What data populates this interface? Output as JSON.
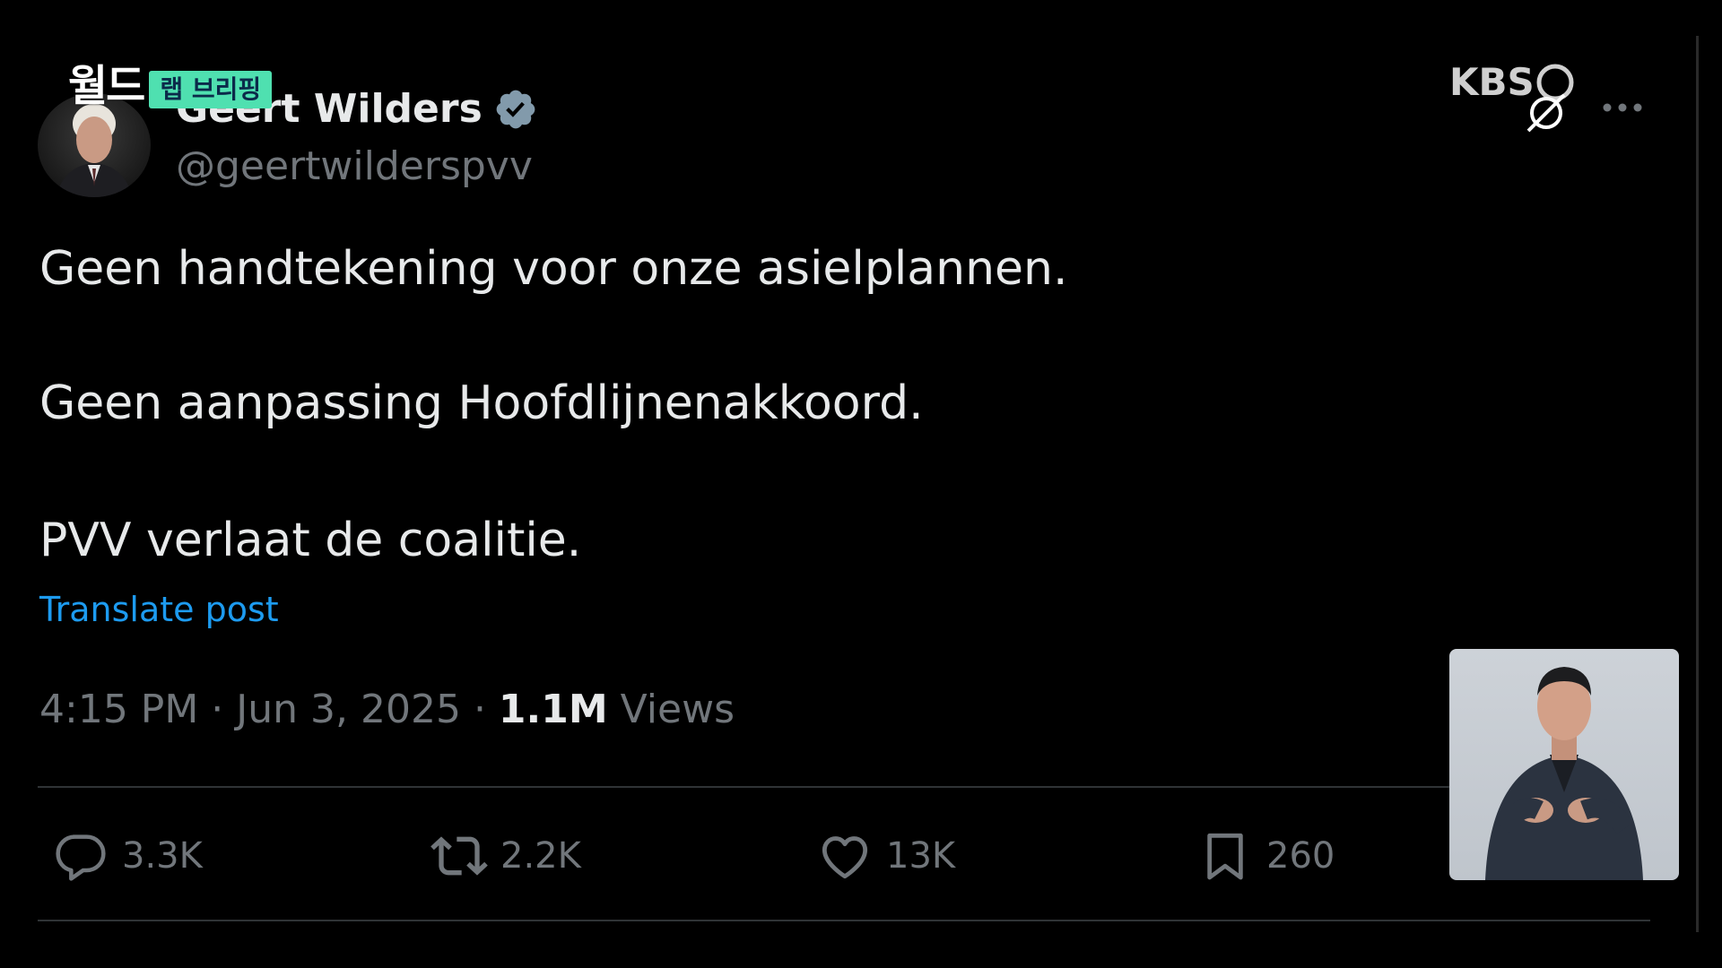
{
  "broadcast": {
    "program": "월드",
    "segment_tag": "랩 브리핑",
    "channel": "KBS"
  },
  "tweet": {
    "display_name": "Geert Wilders",
    "handle": "@geertwilderspvv",
    "lines": [
      "Geen handtekening voor onze asielplannen.",
      "Geen aanpassing Hoofdlijnenakkoord.",
      "PVV verlaat de coalitie."
    ],
    "translate_label": "Translate post",
    "time": "4:15 PM",
    "date": "Jun 3, 2025",
    "separator": " · ",
    "views_count": "1.1M",
    "views_label": "Views",
    "actions": {
      "replies": "3.3K",
      "reposts": "2.2K",
      "likes": "13K",
      "bookmarks": "260"
    }
  },
  "colors": {
    "background": "#000000",
    "text_primary": "#e7e9ea",
    "text_secondary": "#71767b",
    "link": "#1d9bf0",
    "verified": "#829aab",
    "tag_bg": "#4fe0b0"
  },
  "icons": [
    "verified-badge-icon",
    "more-icon",
    "reply-icon",
    "repost-icon",
    "like-icon",
    "bookmark-icon"
  ]
}
